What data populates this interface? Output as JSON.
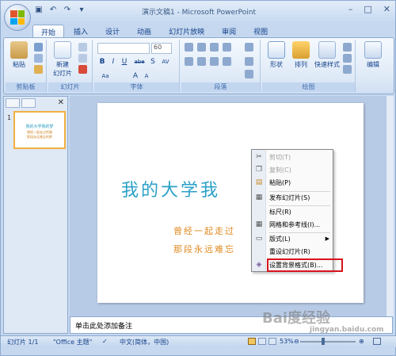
{
  "window": {
    "title": "演示文稿1 - Microsoft PowerPoint"
  },
  "tabs": [
    "开始",
    "插入",
    "设计",
    "动画",
    "幻灯片放映",
    "审阅",
    "视图"
  ],
  "ribbon": {
    "clipboard": {
      "paste": "粘贴",
      "label": "剪贴板"
    },
    "slides": {
      "new_slide_line1": "新建",
      "new_slide_line2": "幻灯片",
      "label": "幻灯片"
    },
    "font": {
      "size": "60",
      "label": "字体",
      "bold": "B",
      "italic": "I",
      "underline": "U",
      "strike": "abe",
      "shadow": "S",
      "spacing": "AV",
      "case": "Aa",
      "grow": "A",
      "shrink": "A"
    },
    "paragraph": {
      "label": "段落"
    },
    "drawing": {
      "shapes": "形状",
      "arrange": "排列",
      "quick_styles": "快速样式",
      "label": "绘图"
    },
    "editing": {
      "label": "编辑"
    }
  },
  "slide_pane": {
    "slide_number": "1"
  },
  "thumbnail": {
    "title": "我的大学我的梦",
    "line1": "曾经一起走过的路",
    "line2": "那段永远难忘的梦"
  },
  "slide": {
    "title": "我的大学我",
    "line1": "曾经一起走过",
    "line2": "那段永远难忘"
  },
  "context_menu": {
    "items": [
      {
        "label": "剪切(T)",
        "disabled": true,
        "icon": "scissors-icon"
      },
      {
        "label": "复制(C)",
        "disabled": true,
        "icon": "copy-icon"
      },
      {
        "label": "粘贴(P)",
        "disabled": false,
        "icon": "paste-icon"
      },
      {
        "label": "发布幻灯片(S)",
        "disabled": false,
        "icon": "publish-icon"
      },
      {
        "label": "标尺(R)",
        "disabled": false,
        "icon": ""
      },
      {
        "label": "网格和参考线(I)...",
        "disabled": false,
        "icon": "grid-icon"
      },
      {
        "label": "版式(L)",
        "disabled": false,
        "icon": "layout-icon"
      },
      {
        "label": "重设幻灯片(R)",
        "disabled": false,
        "icon": ""
      },
      {
        "label": "设置背景格式(B)...",
        "disabled": false,
        "icon": "background-icon"
      }
    ]
  },
  "notes": {
    "placeholder": "单击此处添加备注"
  },
  "statusbar": {
    "slide_info": "幻灯片 1/1",
    "theme": "\"Office 主题\"",
    "language": "中文(简体，中国)",
    "zoom": "53%"
  },
  "watermark": {
    "text": "Bai度经验",
    "sub": "jingyan.baidu.com"
  },
  "colors": {
    "accent": "#15428b",
    "highlight_box": "#d8141e",
    "slide_title": "#2aa0c8",
    "slide_subtitle": "#e08a20"
  }
}
